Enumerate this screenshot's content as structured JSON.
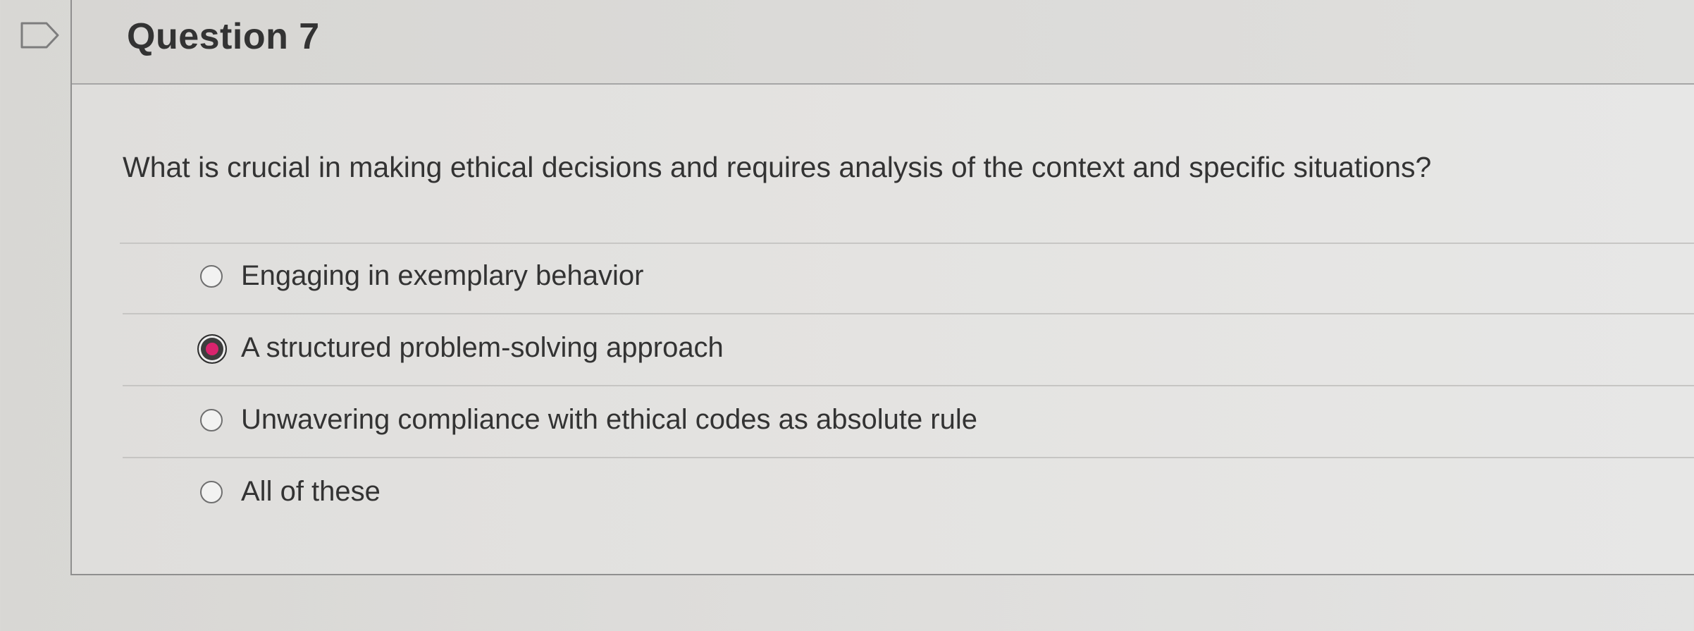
{
  "question": {
    "title": "Question 7",
    "prompt": "What is crucial in making ethical decisions and requires analysis of the context and specific situations?",
    "selected_option_index": 1,
    "options": [
      {
        "label": "Engaging in exemplary behavior"
      },
      {
        "label": "A structured problem-solving approach"
      },
      {
        "label": "Unwavering compliance with ethical codes as absolute rule"
      },
      {
        "label": "All of these"
      }
    ]
  },
  "colors": {
    "selected_radio_accent": "#d8236d",
    "card_border": "#8f8f8f",
    "text": "#333333"
  },
  "icons": {
    "flag": "flag-icon",
    "radio": "radio-icon"
  }
}
